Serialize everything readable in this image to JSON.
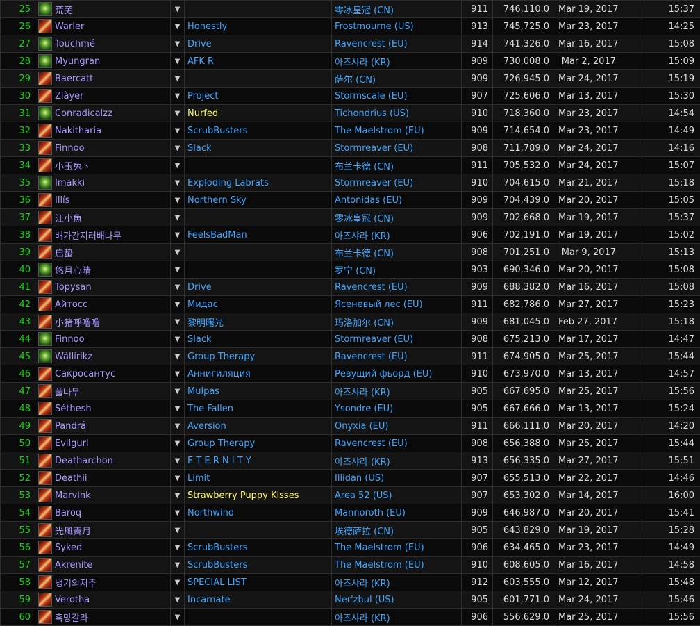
{
  "rows": [
    {
      "rank": "25",
      "spec": "druid",
      "name": "荒芜",
      "guild": "",
      "server": "零冰皇冠 (CN)",
      "ilvl": "911",
      "score": "746,110.0",
      "date": "Mar 19, 2017",
      "time": "15:37"
    },
    {
      "rank": "26",
      "spec": "dh",
      "name": "Warler",
      "guild": "Honestly",
      "server": "Frostmourne (US)",
      "ilvl": "913",
      "score": "745,725.0",
      "date": "Mar 23, 2017",
      "time": "14:25"
    },
    {
      "rank": "27",
      "spec": "druid",
      "name": "Touchmé",
      "guild": "Drive",
      "server": "Ravencrest (EU)",
      "ilvl": "914",
      "score": "741,326.0",
      "date": "Mar 16, 2017",
      "time": "15:08"
    },
    {
      "rank": "28",
      "spec": "druid",
      "name": "Myungran",
      "guild": "AFK R",
      "server": "아즈샤라 (KR)",
      "ilvl": "909",
      "score": "730,008.0",
      "date": "Mar 2, 2017",
      "time": "15:09"
    },
    {
      "rank": "29",
      "spec": "dh",
      "name": "Baercatt",
      "guild": "",
      "server": "萨尔 (CN)",
      "ilvl": "909",
      "score": "726,945.0",
      "date": "Mar 24, 2017",
      "time": "15:19"
    },
    {
      "rank": "30",
      "spec": "dh",
      "name": "Zlàyer",
      "guild": "Project",
      "server": "Stormscale (EU)",
      "ilvl": "907",
      "score": "725,606.0",
      "date": "Mar 13, 2017",
      "time": "15:30"
    },
    {
      "rank": "31",
      "spec": "druid",
      "name": "Conradicalzz",
      "guild": "Nurfed",
      "guild_special": true,
      "server": "Tichondrius (US)",
      "ilvl": "910",
      "score": "718,360.0",
      "date": "Mar 23, 2017",
      "time": "14:54"
    },
    {
      "rank": "32",
      "spec": "dh",
      "name": "Nakitharia",
      "guild": "ScrubBusters",
      "server": "The Maelstrom (EU)",
      "ilvl": "909",
      "score": "714,654.0",
      "date": "Mar 23, 2017",
      "time": "14:49"
    },
    {
      "rank": "33",
      "spec": "dh",
      "name": "Finnoo",
      "guild": "Slack",
      "server": "Stormreaver (EU)",
      "ilvl": "908",
      "score": "711,789.0",
      "date": "Mar 24, 2017",
      "time": "14:16"
    },
    {
      "rank": "34",
      "spec": "dh",
      "name": "小玉兔丶",
      "guild": "",
      "server": "布兰卡德 (CN)",
      "ilvl": "911",
      "score": "705,532.0",
      "date": "Mar 24, 2017",
      "time": "15:07"
    },
    {
      "rank": "35",
      "spec": "druid",
      "name": "Imakki",
      "guild": "Exploding Labrats",
      "server": "Stormreaver (EU)",
      "ilvl": "910",
      "score": "704,615.0",
      "date": "Mar 21, 2017",
      "time": "15:18"
    },
    {
      "rank": "36",
      "spec": "dh",
      "name": "Illís",
      "guild": "Northern Sky",
      "server": "Antonidas (EU)",
      "ilvl": "909",
      "score": "704,439.0",
      "date": "Mar 20, 2017",
      "time": "15:05"
    },
    {
      "rank": "37",
      "spec": "dh",
      "name": "江小魚",
      "guild": "",
      "server": "零冰皇冠 (CN)",
      "ilvl": "909",
      "score": "702,668.0",
      "date": "Mar 19, 2017",
      "time": "15:37"
    },
    {
      "rank": "38",
      "spec": "dh",
      "name": "배가간지러배나무",
      "guild": "FeelsBadMan",
      "server": "아즈샤라 (KR)",
      "ilvl": "906",
      "score": "702,191.0",
      "date": "Mar 19, 2017",
      "time": "15:02"
    },
    {
      "rank": "39",
      "spec": "dh",
      "name": "启蛰",
      "guild": "",
      "server": "布兰卡德 (CN)",
      "ilvl": "908",
      "score": "701,251.0",
      "date": "Mar 9, 2017",
      "time": "15:13"
    },
    {
      "rank": "40",
      "spec": "druid",
      "name": "悠月心晴",
      "guild": "",
      "server": "罗宁 (CN)",
      "ilvl": "903",
      "score": "690,346.0",
      "date": "Mar 20, 2017",
      "time": "15:08"
    },
    {
      "rank": "41",
      "spec": "dh",
      "name": "Topysan",
      "guild": "Drive",
      "server": "Ravencrest (EU)",
      "ilvl": "909",
      "score": "688,382.0",
      "date": "Mar 16, 2017",
      "time": "15:08"
    },
    {
      "rank": "42",
      "spec": "dh",
      "name": "Айтосс",
      "guild": "Мидас",
      "server": "Ясеневый лес (EU)",
      "ilvl": "911",
      "score": "682,786.0",
      "date": "Mar 27, 2017",
      "time": "15:23"
    },
    {
      "rank": "43",
      "spec": "dh",
      "name": "小猪呼噜噜",
      "guild": "黎明曙光",
      "server": "玛洛加尔 (CN)",
      "ilvl": "909",
      "score": "681,045.0",
      "date": "Feb 27, 2017",
      "time": "15:18"
    },
    {
      "rank": "44",
      "spec": "druid",
      "name": "Finnoo",
      "guild": "Slack",
      "server": "Stormreaver (EU)",
      "ilvl": "908",
      "score": "675,213.0",
      "date": "Mar 17, 2017",
      "time": "14:47"
    },
    {
      "rank": "45",
      "spec": "druid",
      "name": "Wällirikz",
      "guild": "Group Therapy",
      "server": "Ravencrest (EU)",
      "ilvl": "911",
      "score": "674,905.0",
      "date": "Mar 25, 2017",
      "time": "15:44"
    },
    {
      "rank": "46",
      "spec": "dh",
      "name": "Сакросантус",
      "guild": "Аннигиляция",
      "server": "Ревущий фьорд (EU)",
      "ilvl": "910",
      "score": "673,970.0",
      "date": "Mar 13, 2017",
      "time": "14:57"
    },
    {
      "rank": "47",
      "spec": "dh",
      "name": "풀나무",
      "guild": "Mulpas",
      "server": "아즈샤라 (KR)",
      "ilvl": "905",
      "score": "667,695.0",
      "date": "Mar 25, 2017",
      "time": "15:56"
    },
    {
      "rank": "48",
      "spec": "dh",
      "name": "Séthesh",
      "guild": "The Fallen",
      "server": "Ysondre (EU)",
      "ilvl": "905",
      "score": "667,666.0",
      "date": "Mar 13, 2017",
      "time": "15:24"
    },
    {
      "rank": "49",
      "spec": "dh",
      "name": "Pandrá",
      "guild": "Aversion",
      "server": "Onyxia (EU)",
      "ilvl": "911",
      "score": "666,111.0",
      "date": "Mar 20, 2017",
      "time": "14:20"
    },
    {
      "rank": "50",
      "spec": "dh",
      "name": "Evilgurl",
      "guild": "Group Therapy",
      "server": "Ravencrest (EU)",
      "ilvl": "908",
      "score": "656,388.0",
      "date": "Mar 25, 2017",
      "time": "15:44"
    },
    {
      "rank": "51",
      "spec": "dh",
      "name": "Deatharchon",
      "guild": "E T E R N I T Y",
      "server": "아즈샤라 (KR)",
      "ilvl": "913",
      "score": "656,335.0",
      "date": "Mar 27, 2017",
      "time": "15:51"
    },
    {
      "rank": "52",
      "spec": "dh",
      "name": "Deathii",
      "guild": "Limit",
      "server": "Illidan (US)",
      "ilvl": "907",
      "score": "655,513.0",
      "date": "Mar 22, 2017",
      "time": "14:46"
    },
    {
      "rank": "53",
      "spec": "dh",
      "name": "Marvink",
      "guild": "Strawberry Puppy Kisses",
      "guild_special": true,
      "server": "Area 52 (US)",
      "ilvl": "907",
      "score": "653,302.0",
      "date": "Mar 14, 2017",
      "time": "16:00"
    },
    {
      "rank": "54",
      "spec": "dh",
      "name": "Baroq",
      "guild": "Northwind",
      "server": "Mannoroth (EU)",
      "ilvl": "909",
      "score": "646,987.0",
      "date": "Mar 20, 2017",
      "time": "15:41"
    },
    {
      "rank": "55",
      "spec": "dh",
      "name": "光風霽月",
      "guild": "",
      "server": "埃德萨拉 (CN)",
      "ilvl": "905",
      "score": "643,829.0",
      "date": "Mar 19, 2017",
      "time": "15:28"
    },
    {
      "rank": "56",
      "spec": "dh",
      "name": "Syked",
      "guild": "ScrubBusters",
      "server": "The Maelstrom (EU)",
      "ilvl": "906",
      "score": "634,465.0",
      "date": "Mar 23, 2017",
      "time": "14:49"
    },
    {
      "rank": "57",
      "spec": "dh",
      "name": "Akrenite",
      "guild": "ScrubBusters",
      "server": "The Maelstrom (EU)",
      "ilvl": "910",
      "score": "608,605.0",
      "date": "Mar 16, 2017",
      "time": "14:58"
    },
    {
      "rank": "58",
      "spec": "dh",
      "name": "냉기의저주",
      "guild": "SPECIAL LIST",
      "server": "아즈샤라 (KR)",
      "ilvl": "912",
      "score": "603,555.0",
      "date": "Mar 12, 2017",
      "time": "15:48"
    },
    {
      "rank": "59",
      "spec": "dh",
      "name": "Verotha",
      "guild": "Incarnate",
      "server": "Ner'zhul (US)",
      "ilvl": "905",
      "score": "601,771.0",
      "date": "Mar 24, 2017",
      "time": "15:46"
    },
    {
      "rank": "60",
      "spec": "dh",
      "name": "흑망갈라",
      "guild": "",
      "server": "아즈샤라 (KR)",
      "ilvl": "906",
      "score": "556,629.0",
      "date": "Mar 25, 2017",
      "time": "15:56"
    }
  ],
  "icons": {
    "dh": "demon-hunter-spec-icon",
    "druid": "druid-spec-icon",
    "dropdown": "▼"
  },
  "colors": {
    "rank": "#19d219",
    "name": "#a79cff",
    "link": "#40a6ff",
    "highlight_guild": "#ffff66",
    "row_odd": "#141414",
    "row_even": "#0a0a0a",
    "border": "#2e2e2e"
  }
}
